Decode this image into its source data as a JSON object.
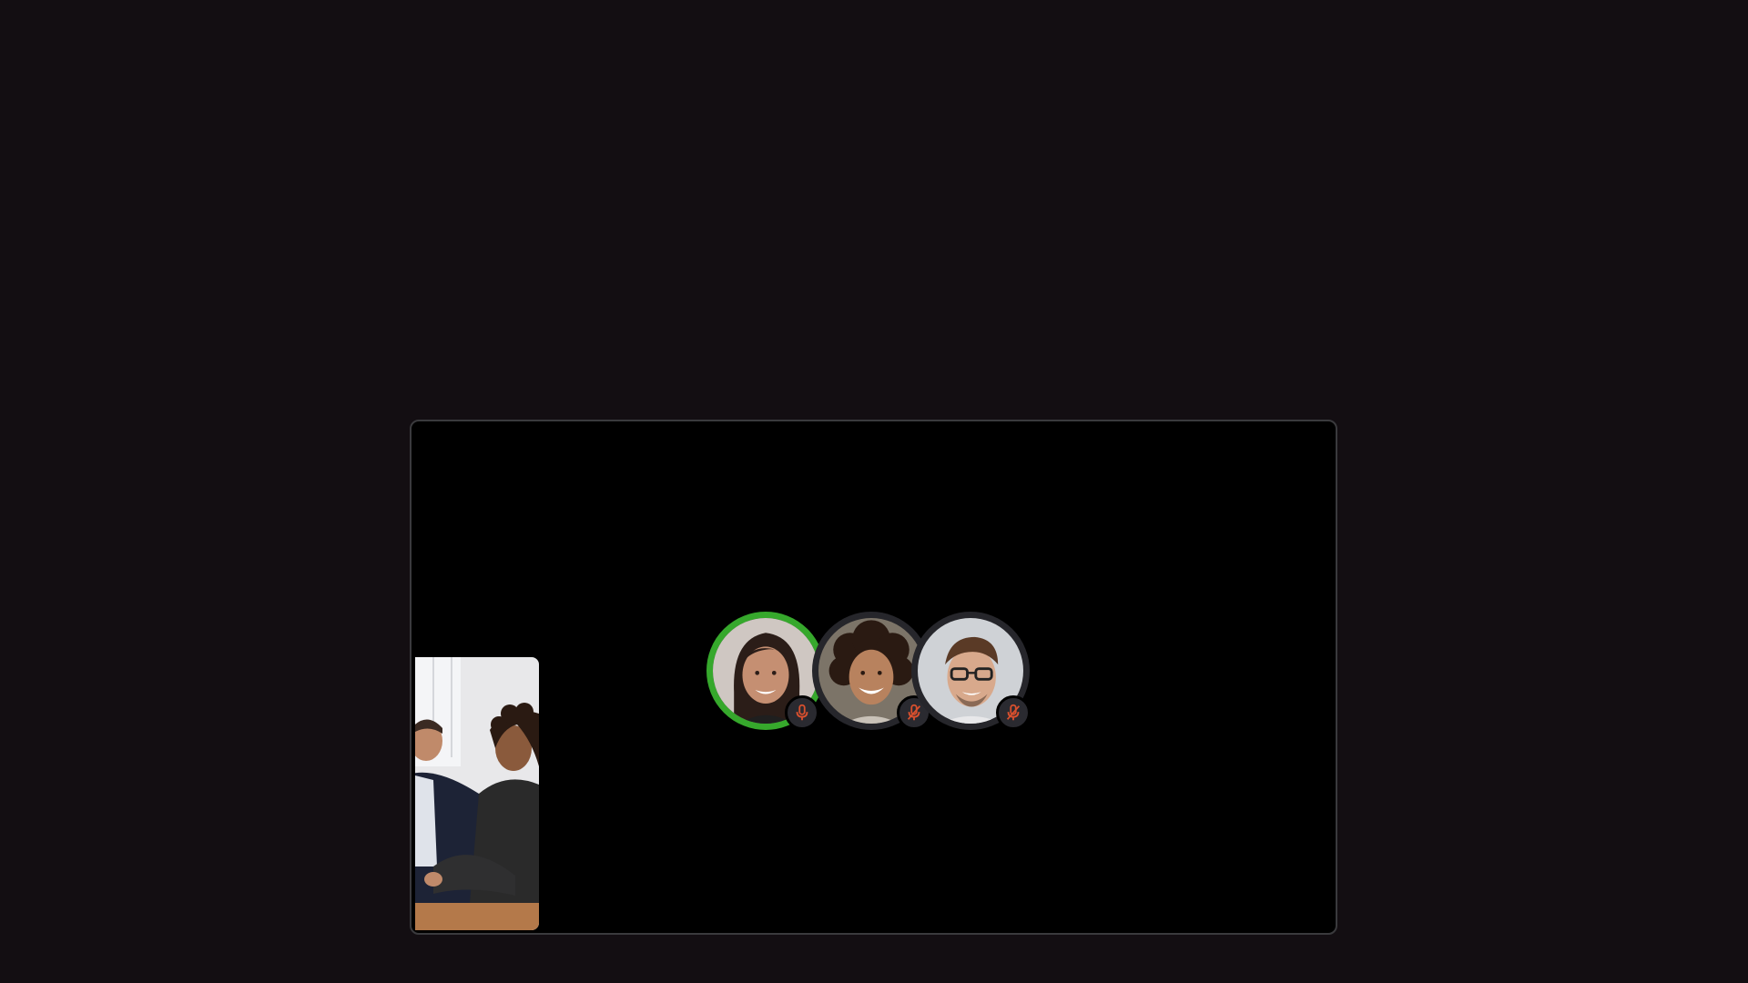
{
  "app": {
    "background_color": "#130e12"
  },
  "call": {
    "participants": [
      {
        "name_hidden": true,
        "speaking": true,
        "mic_state": "mic-on-icon",
        "mic_color": "#d9502e"
      },
      {
        "name_hidden": true,
        "speaking": false,
        "mic_state": "mic-off-icon",
        "mic_color": "#d9502e"
      },
      {
        "name_hidden": true,
        "speaking": false,
        "mic_state": "mic-off-icon",
        "mic_color": "#d9502e"
      }
    ],
    "colors": {
      "speaking_ring": "#36a82c",
      "idle_ring": "#26262b",
      "stage_background": "#000000"
    }
  }
}
